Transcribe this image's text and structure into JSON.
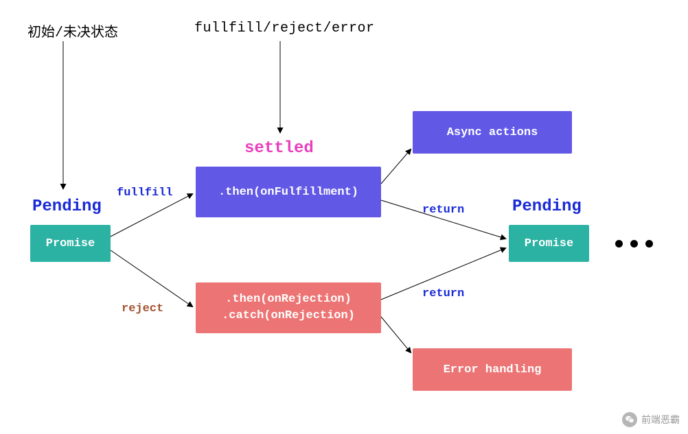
{
  "annotations": {
    "initial_state": "初始/未决状态",
    "triggers": "fullfill/reject/error"
  },
  "pending_label_left": "Pending",
  "pending_label_right": "Pending",
  "settled_label": "settled",
  "edge_labels": {
    "fullfill": "fullfill",
    "reject": "reject",
    "return_top": "return",
    "return_bottom": "return"
  },
  "boxes": {
    "promise_left": "Promise",
    "then_fulfill": ".then(onFulfillment)",
    "then_reject_line1": ".then(onRejection)",
    "then_reject_line2": ".catch(onRejection)",
    "async_actions": "Async actions",
    "error_handling": "Error handling",
    "promise_right": "Promise"
  },
  "continuation": "...",
  "colors": {
    "teal": "#2bb2a3",
    "purple": "#6158e6",
    "red": "#ed7474",
    "purple_text": "#6158e6",
    "magenta": "#e83fbd",
    "blue": "#1a2bd6",
    "brown": "#a35230",
    "black": "#000000"
  },
  "watermark": "前端恶霸"
}
